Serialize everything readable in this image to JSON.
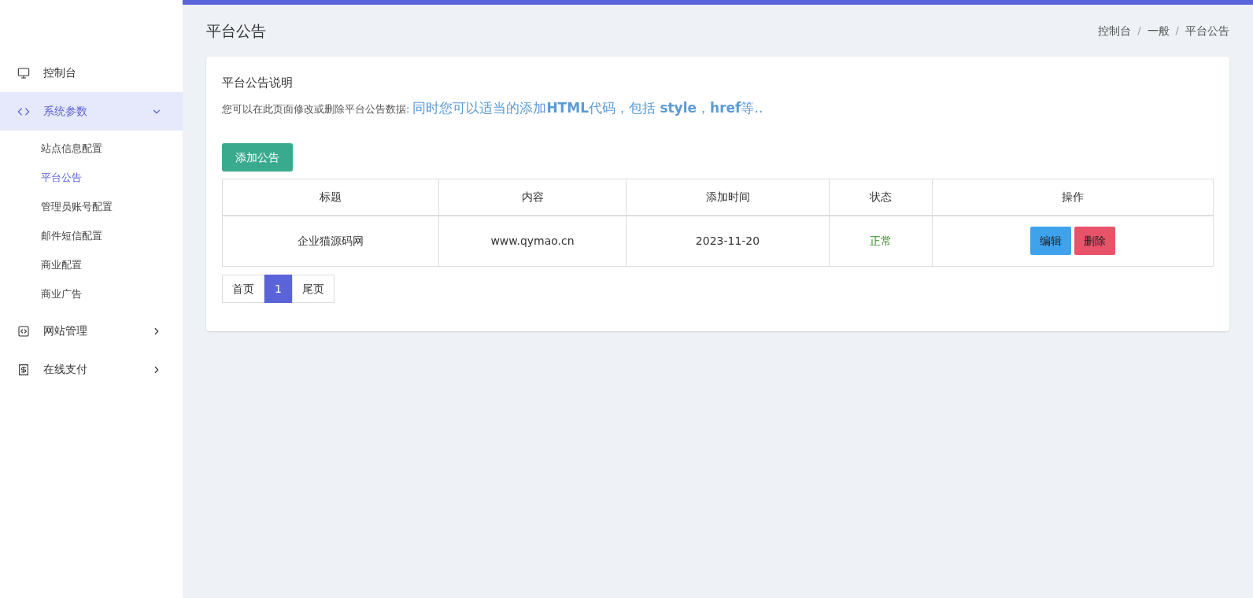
{
  "sidebar": {
    "items": [
      {
        "label": "控制台",
        "selected": false
      },
      {
        "label": "系统参数",
        "selected": true,
        "expanded": true,
        "children": [
          {
            "label": "站点信息配置",
            "selected": false
          },
          {
            "label": "平台公告",
            "selected": true
          },
          {
            "label": "管理员账号配置",
            "selected": false
          },
          {
            "label": "邮件短信配置",
            "selected": false
          },
          {
            "label": "商业配置",
            "selected": false
          },
          {
            "label": "商业广告",
            "selected": false
          }
        ]
      },
      {
        "label": "网站管理",
        "selected": false,
        "expanded": false
      },
      {
        "label": "在线支付",
        "selected": false,
        "expanded": false
      }
    ]
  },
  "page_title": "平台公告",
  "breadcrumb": [
    {
      "kind": "link",
      "label": "控制台"
    },
    {
      "kind": "separator",
      "label": "/"
    },
    {
      "kind": "link",
      "label": "一般"
    },
    {
      "kind": "separator",
      "label": "/"
    },
    {
      "kind": "link",
      "label": "平台公告"
    }
  ],
  "card": {
    "title": "平台公告说明",
    "description": "您可以在此页面修改或删除平台公告数据:",
    "highlight": "同时您可以适当的添加**HTML**代码，包括 **style**，**href**等..",
    "add_button": "添加公告",
    "table": {
      "columns": [
        "标题",
        "内容",
        "添加时间",
        "状态",
        "操作"
      ],
      "rows": [
        {
          "title": "企业猫源码网",
          "content": "www.qymao.cn",
          "time": "2023-11-20",
          "status": "正常",
          "actions": [
            "编辑",
            "删除"
          ]
        }
      ]
    },
    "pagination": [
      {
        "label": "首页",
        "selected": false
      },
      {
        "label": "1",
        "selected": true
      },
      {
        "label": "尾页",
        "selected": false
      }
    ]
  }
}
